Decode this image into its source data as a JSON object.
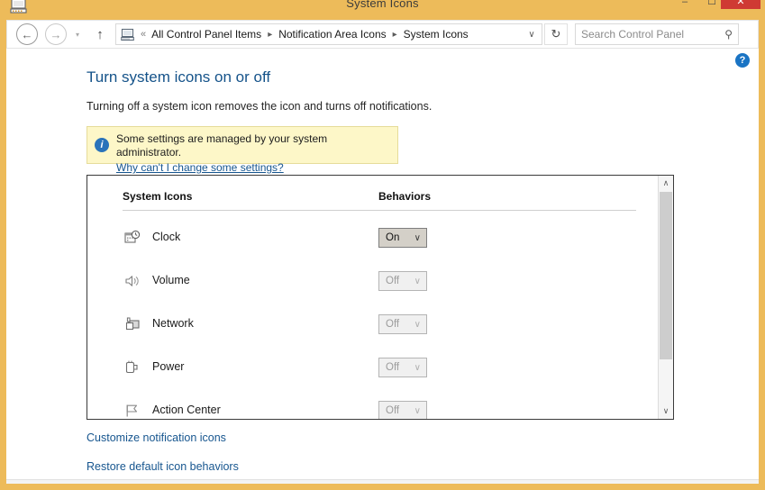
{
  "window": {
    "title": "System Icons",
    "app_icon": "computer-icon",
    "minimize_label": "–",
    "maximize_label": "☐",
    "close_label": "✕",
    "accent_yellow": "#edbb5a",
    "close_red": "#cf3a33"
  },
  "toolbar": {
    "back_label": "←",
    "forward_label": "→",
    "recent_label": "▾",
    "up_label": "↑",
    "address_icon": "computer-icon",
    "address_prefix": "«",
    "breadcrumbs": [
      "All Control Panel Items",
      "Notification Area Icons",
      "System Icons"
    ],
    "breadcrumb_separator": "▸",
    "address_dropdown_label": "∨",
    "refresh_label": "↻",
    "search": {
      "placeholder": "Search Control Panel",
      "value": "",
      "icon": "search-icon",
      "icon_glyph": "⚲"
    }
  },
  "content": {
    "help_label": "?",
    "page_title": "Turn system icons on or off",
    "page_description": "Turning off a system icon removes the icon and turns off notifications.",
    "banner": {
      "icon": "info-icon",
      "icon_glyph": "i",
      "text": "Some settings are managed by your system administrator.",
      "link": "Why can't I change some settings?",
      "background": "#fdf7c8"
    },
    "table": {
      "headers": {
        "icons": "System Icons",
        "behaviors": "Behaviors"
      },
      "rows": [
        {
          "icon": "clock-icon",
          "label": "Clock",
          "behavior": "On",
          "enabled": true
        },
        {
          "icon": "volume-icon",
          "label": "Volume",
          "behavior": "Off",
          "enabled": false
        },
        {
          "icon": "network-icon",
          "label": "Network",
          "behavior": "Off",
          "enabled": false
        },
        {
          "icon": "power-icon",
          "label": "Power",
          "behavior": "Off",
          "enabled": false
        },
        {
          "icon": "action-center-icon",
          "label": "Action Center",
          "behavior": "Off",
          "enabled": false
        }
      ],
      "select_chevron": "∨"
    },
    "scrollbar": {
      "up_label": "∧",
      "down_label": "∨"
    },
    "links": [
      "Customize notification icons",
      "Restore default icon behaviors"
    ]
  }
}
